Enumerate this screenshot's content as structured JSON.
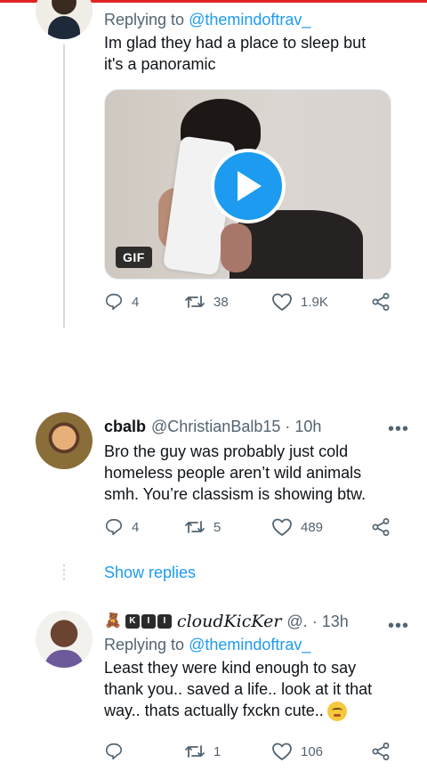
{
  "tweet1": {
    "reply_prefix": "Replying to",
    "reply_handle": "@themindoftrav_",
    "text": "Im glad they had a place to sleep but it's  a panoramic",
    "media_badge": "GIF",
    "stats": {
      "replies": "4",
      "retweets": "38",
      "likes": "1.9K"
    }
  },
  "tweet2": {
    "name": "cbalb",
    "handle": "@ChristianBalb15",
    "separator": "·",
    "time": "10h",
    "text": "Bro the guy was probably just cold homeless people aren’t wild animals smh. You’re classism is showing btw.",
    "stats": {
      "replies": "4",
      "retweets": "5",
      "likes": "489"
    },
    "show_replies": "Show replies"
  },
  "tweet3": {
    "name_emoji": "🧸",
    "badge_letters": [
      "K",
      "I",
      "I"
    ],
    "display_name": "cloudKicKer",
    "handle": "@.",
    "separator": "·",
    "time": "13h",
    "reply_prefix": "Replying to",
    "reply_handle": "@themindoftrav_",
    "text": "Least they were kind enough to say thank you.. saved a life.. look at it that way.. thats actually fxckn cute..",
    "stats": {
      "replies": "",
      "retweets": "1",
      "likes": "106"
    }
  },
  "icons": {
    "reply": "reply-icon",
    "retweet": "retweet-icon",
    "like": "heart-icon",
    "share": "share-icon",
    "more": "more-dots-icon",
    "play": "play-icon"
  },
  "colors": {
    "accent": "#1d9bf0",
    "muted": "#536471",
    "text": "#0f1419"
  }
}
